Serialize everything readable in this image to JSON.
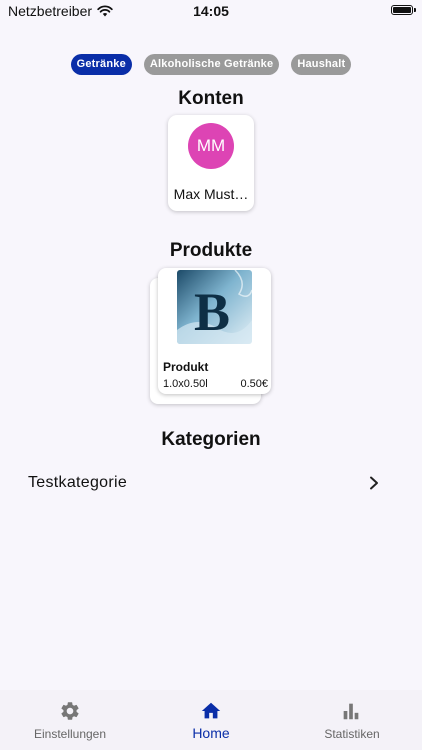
{
  "status_bar": {
    "carrier": "Netzbetreiber",
    "time": "14:05",
    "battery_level": 1.0
  },
  "filter_chips": [
    {
      "label": "Getränke",
      "active": true
    },
    {
      "label": "Alkoholische Getränke",
      "active": false
    },
    {
      "label": "Haushalt",
      "active": false
    }
  ],
  "accounts": {
    "title": "Konten",
    "items": [
      {
        "initials": "MM",
        "name": "Max Must…",
        "avatar_color": "#dd44b4"
      }
    ]
  },
  "products": {
    "title": "Produkte",
    "items": [
      {
        "name": "Produkt",
        "quantity": "1.0x0.50l",
        "price": "0.50€",
        "image": "B"
      }
    ]
  },
  "categories": {
    "title": "Kategorien",
    "items": [
      {
        "label": "Testkategorie"
      }
    ]
  },
  "tab_bar": {
    "items": [
      {
        "label": "Einstellungen",
        "icon": "gear-icon",
        "active": false
      },
      {
        "label": "Home",
        "icon": "home-icon",
        "active": true
      },
      {
        "label": "Statistiken",
        "icon": "bar-chart-icon",
        "active": false
      }
    ]
  },
  "colors": {
    "accent": "#0a2ea8",
    "chip_inactive": "#9a9a9a",
    "background": "#f8f6fc"
  }
}
